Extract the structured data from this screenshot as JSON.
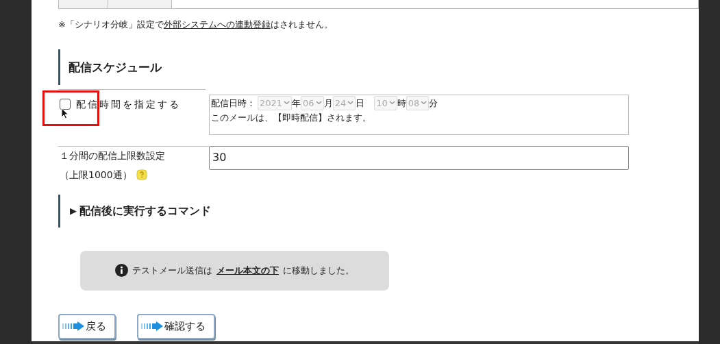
{
  "note": {
    "before": "※「シナリオ分岐」設定で",
    "link": "外部システムへの連動登録",
    "after": "はされません。"
  },
  "schedule": {
    "title": "配信スケジュール",
    "checkbox": {
      "label": "配信時間を指定する",
      "checked": false
    },
    "datetime_label": "配信日時：",
    "disabled": true,
    "selects": [
      {
        "value": "2021",
        "unit": "年"
      },
      {
        "value": "06",
        "unit": "月"
      },
      {
        "value": "24",
        "unit": "日"
      },
      {
        "value": "10",
        "unit": "時"
      },
      {
        "value": "08",
        "unit": "分"
      }
    ],
    "message": "このメールは、【即時配信】されます。"
  },
  "rate_limit": {
    "label": "１分間の配信上限数設定",
    "sublabel": "（上限1000通）",
    "value": "30"
  },
  "command_section": {
    "toggle": "▶",
    "title": "配信後に実行するコマンド"
  },
  "notice": {
    "before": "テストメール送信は",
    "link": "メール本文の下",
    "after": "に移動しました。"
  },
  "buttons": [
    "戻る",
    "確認する"
  ]
}
